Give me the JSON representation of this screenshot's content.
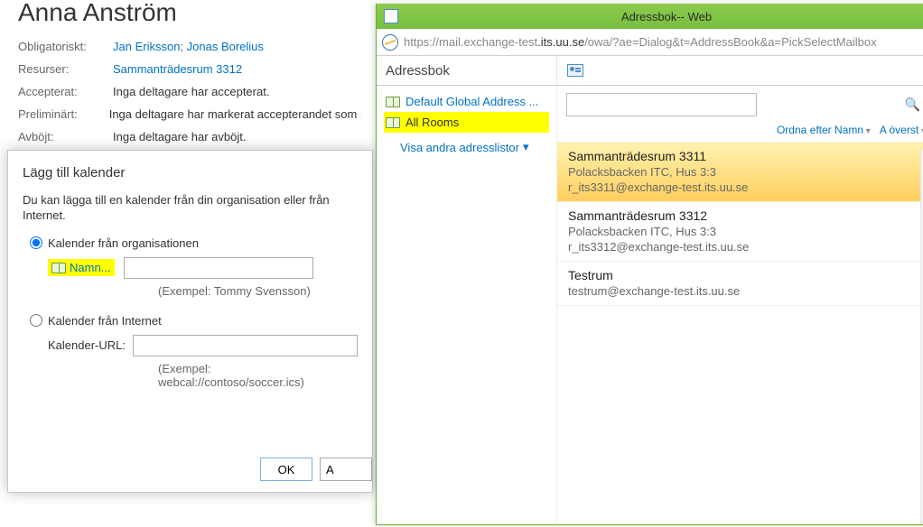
{
  "bg": {
    "title": "Anna Anström",
    "rows": {
      "obligatoriskt_label": "Obligatoriskt:",
      "obligatoriskt_value": "Jan Eriksson; Jonas Borelius",
      "resurser_label": "Resurser:",
      "resurser_value": "Sammanträdesrum 3312",
      "accepterat_label": "Accepterat:",
      "accepterat_value": "Inga deltagare har accepterat.",
      "preliminart_label": "Preliminärt:",
      "preliminart_value": "Inga deltagare har markerat accepterandet som Pr",
      "avbojt_label": "Avböjt:",
      "avbojt_value": "Inga deltagare har avböjt."
    }
  },
  "dialog": {
    "heading": "Lägg till kalender",
    "intro": "Du kan lägga till en kalender från din organisation eller från Internet.",
    "opt_org": "Kalender från organisationen",
    "name_btn": "Namn...",
    "example_name": "(Exempel: Tommy Svensson)",
    "opt_internet": "Kalender från Internet",
    "url_label": "Kalender-URL:",
    "example_url": "(Exempel: webcal://contoso/soccer.ics)",
    "ok": "OK",
    "cancel": "A"
  },
  "ab": {
    "window_title": "Adressbok-- Web",
    "url_scheme": "https://",
    "url_host_grey": "mail.exchange-test",
    "url_host_dark": ".its.uu.se",
    "url_path": "/owa/?ae=Dialog&t=AddressBook&a=PickSelectMailbox",
    "toolbar_label": "Adressbok",
    "left_items": [
      {
        "label": "Default Global Address ...",
        "selected": false
      },
      {
        "label": "All Rooms",
        "selected": true
      }
    ],
    "show_other": "Visa andra adresslistor",
    "sort_by": "Ordna efter Namn",
    "sort_dir": "A överst",
    "search_placeholder": "",
    "results": [
      {
        "title": "Sammanträdesrum 3311",
        "sub": "Polacksbacken ITC, Hus 3:3",
        "mail": "r_its3311@exchange-test.its.uu.se",
        "selected": true
      },
      {
        "title": "Sammanträdesrum 3312",
        "sub": "Polacksbacken ITC, Hus 3:3",
        "mail": "r_its3312@exchange-test.its.uu.se",
        "selected": false
      },
      {
        "title": "Testrum",
        "sub": "",
        "mail": "testrum@exchange-test.its.uu.se",
        "selected": false
      }
    ]
  }
}
